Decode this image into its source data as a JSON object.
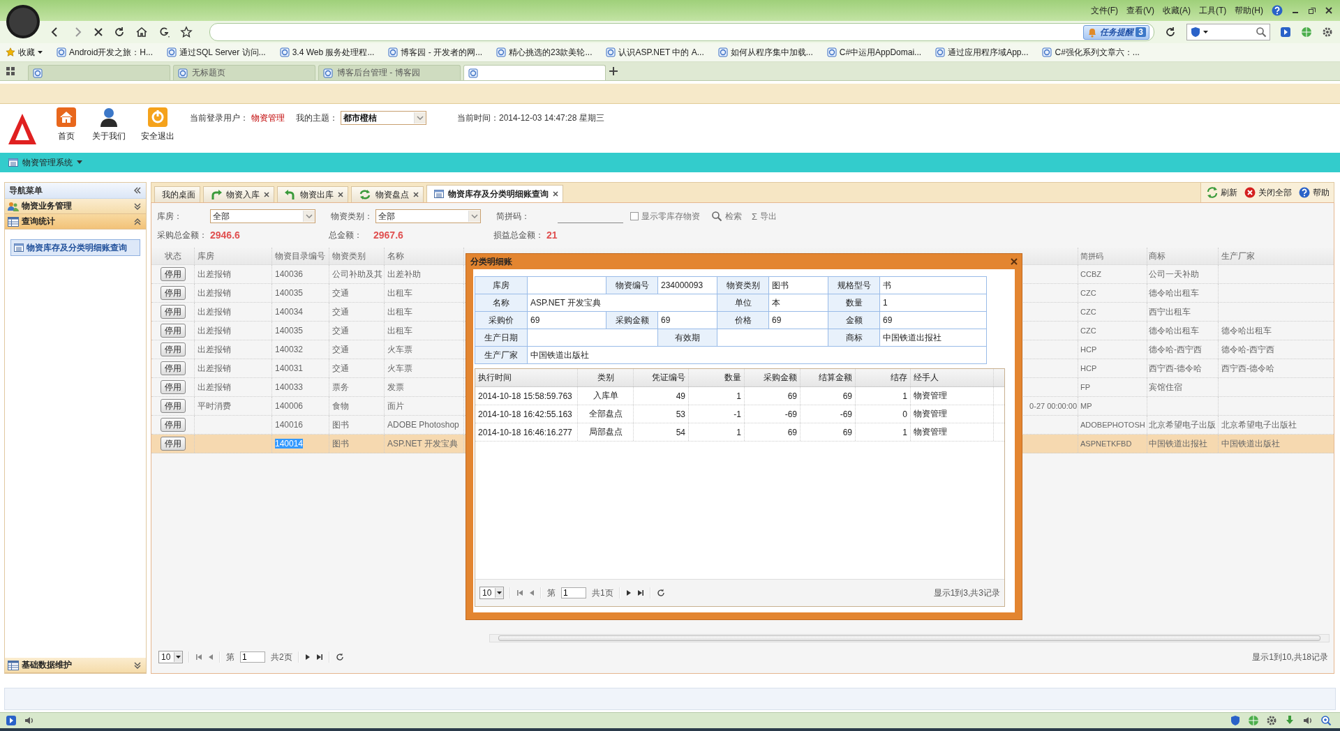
{
  "browser": {
    "menu": [
      "文件(F)",
      "查看(V)",
      "收藏(A)",
      "工具(T)",
      "帮助(H)"
    ],
    "notice": {
      "label": "任务提醒",
      "count": "3"
    },
    "favorites_label": "收藏",
    "favorites": [
      "Android开发之旅：H...",
      "通过SQL Server 访问...",
      "3.4 Web 服务处理程...",
      "博客园 - 开发者的网...",
      "精心挑选的23款美轮...",
      "认识ASP.NET 中的 A...",
      "如何从程序集中加载...",
      "C#中运用AppDomai...",
      "通过应用程序域App...",
      "C#强化系列文章六：..."
    ],
    "tabs": [
      {
        "selected": false
      },
      {
        "label": "无标题页",
        "selected": false
      },
      {
        "label": "博客后台管理 - 博客园",
        "selected": false
      },
      {
        "selected": true
      }
    ]
  },
  "app": {
    "nav": [
      {
        "kind": "home",
        "label": "首页"
      },
      {
        "kind": "about",
        "label": "关于我们"
      },
      {
        "kind": "logout",
        "label": "安全退出"
      }
    ],
    "user_label": "当前登录用户：",
    "user": "物资管理",
    "theme_label": "我的主题：",
    "theme": "都市橙桔",
    "time": "当前时间：2014-12-03 14:47:28 星期三",
    "system_menu": "物资管理系统"
  },
  "sidebar": {
    "title": "导航菜单",
    "groups": [
      {
        "label": "物资业务管理",
        "kind": "users",
        "expanded": false
      },
      {
        "label": "查询统计",
        "kind": "table",
        "expanded": true,
        "items": [
          {
            "label": "物资库存及分类明细账查询",
            "selected": true
          }
        ]
      },
      {
        "label": "基础数据维护",
        "kind": "table",
        "expanded": false
      }
    ]
  },
  "tabs": [
    {
      "kind": "desktop",
      "label": "我的桌面",
      "closable": false,
      "selected": false
    },
    {
      "kind": "inbound",
      "label": "物资入库",
      "closable": true,
      "selected": false
    },
    {
      "kind": "outbound",
      "label": "物资出库",
      "closable": true,
      "selected": false
    },
    {
      "kind": "stocktake",
      "label": "物资盘点",
      "closable": true,
      "selected": false
    },
    {
      "kind": "query",
      "label": "物资库存及分类明细账查询",
      "closable": true,
      "selected": true
    }
  ],
  "tab_tools": [
    {
      "kind": "refresh",
      "label": "刷新"
    },
    {
      "kind": "close-all",
      "label": "关闭全部"
    },
    {
      "kind": "help",
      "label": "帮助"
    }
  ],
  "filters": {
    "warehouse_label": "库房：",
    "warehouse": "全部",
    "category_label": "物资类别：",
    "category": "全部",
    "pinyin_label": "简拼码：",
    "zero_stock": {
      "label": "显示零库存物资",
      "checked": false
    },
    "search": "检索",
    "export_glyph": "Σ",
    "export": "导出"
  },
  "totals": [
    {
      "label": "采购总金额：",
      "value": "2946.6"
    },
    {
      "label": "总金额：",
      "value": "2967.6"
    },
    {
      "label": "损益总金额：",
      "value": "21"
    }
  ],
  "grid": {
    "columns": [
      "状态",
      "库房",
      "物资目录编号",
      "物资类别",
      "名称",
      "简拼码",
      "商标",
      "生产厂家"
    ],
    "rows": [
      {
        "status_button": "停用",
        "warehouse": "出差报销",
        "code": "140036",
        "category": "公司补助及其",
        "name": "出差补助",
        "jianpin": "CCBZ",
        "brand": "公司一天补助",
        "selected": false,
        "code_highlighted": false
      },
      {
        "status_button": "停用",
        "warehouse": "出差报销",
        "code": "140035",
        "category": "交通",
        "name": "出租车",
        "jianpin": "CZC",
        "brand": "德令哈出租车",
        "selected": false,
        "code_highlighted": false
      },
      {
        "status_button": "停用",
        "warehouse": "出差报销",
        "code": "140034",
        "category": "交通",
        "name": "出租车",
        "jianpin": "CZC",
        "brand": "西宁出租车",
        "selected": false,
        "code_highlighted": false
      },
      {
        "status_button": "停用",
        "warehouse": "出差报销",
        "code": "140035",
        "category": "交通",
        "name": "出租车",
        "jianpin": "CZC",
        "brand": "德令哈出租车",
        "maker": "德令哈出租车",
        "selected": false,
        "code_highlighted": false
      },
      {
        "status_button": "停用",
        "warehouse": "出差报销",
        "code": "140032",
        "category": "交通",
        "name": "火车票",
        "jianpin": "HCP",
        "brand": "德令哈-西宁西",
        "maker": "德令哈-西宁西",
        "selected": false,
        "code_highlighted": false
      },
      {
        "status_button": "停用",
        "warehouse": "出差报销",
        "code": "140031",
        "category": "交通",
        "name": "火车票",
        "jianpin": "HCP",
        "brand": "西宁西-德令哈",
        "maker": "西宁西-德令哈",
        "selected": false,
        "code_highlighted": false
      },
      {
        "status_button": "停用",
        "warehouse": "出差报销",
        "code": "140033",
        "category": "票务",
        "name": "发票",
        "jianpin": "FP",
        "brand": "宾馆住宿",
        "selected": false,
        "code_highlighted": false
      },
      {
        "status_button": "停用",
        "warehouse": "平时消费",
        "code": "140006",
        "category": "食物",
        "name": "面片",
        "column_6": "0-27 00:00:00",
        "jianpin": "MP",
        "selected": false,
        "code_highlighted": false
      },
      {
        "status_button": "停用",
        "code": "140016",
        "category": "图书",
        "name": "ADOBE Photoshop",
        "jianpin": "ADOBEPHOTOSH",
        "brand": "北京希望电子出版",
        "maker": "北京希望电子出版社",
        "selected": false,
        "code_highlighted": false
      },
      {
        "status_button": "停用",
        "code": "140014",
        "category": "图书",
        "name": "ASP.NET 开发宝典",
        "jianpin": "ASPNETKFBD",
        "brand": "中国铁道出报社",
        "maker": "中国铁道出版社",
        "selected": true,
        "code_highlighted": true
      }
    ],
    "pager": {
      "page_size": "10",
      "page_label": "第",
      "page": "1",
      "total_pages": "共2页",
      "summary": "显示1到10,共18记录"
    }
  },
  "dialog": {
    "title": "分类明细账",
    "info_rows": [
      [
        {
          "kind": "label",
          "text": "库房"
        },
        {
          "kind": "value"
        },
        {
          "kind": "label",
          "text": "物资编号"
        },
        {
          "kind": "value",
          "text": "234000093"
        },
        {
          "kind": "label",
          "text": "物资类别"
        },
        {
          "kind": "value",
          "text": "图书"
        },
        {
          "kind": "label",
          "text": "规格型号"
        },
        {
          "kind": "value",
          "text": "书"
        }
      ],
      [
        {
          "kind": "label",
          "text": "名称"
        },
        {
          "kind": "value",
          "text": "ASP.NET 开发宝典"
        },
        {
          "kind": "label",
          "text": "单位"
        },
        {
          "kind": "value",
          "text": "本"
        },
        {
          "kind": "label",
          "text": "数量"
        },
        {
          "kind": "value",
          "text": "1"
        }
      ],
      [
        {
          "kind": "label",
          "text": "采购价"
        },
        {
          "kind": "value",
          "text": "69"
        },
        {
          "kind": "label",
          "text": "采购金额"
        },
        {
          "kind": "value",
          "text": "69"
        },
        {
          "kind": "label",
          "text": "价格"
        },
        {
          "kind": "value",
          "text": "69"
        },
        {
          "kind": "label",
          "text": "金额"
        },
        {
          "kind": "value",
          "text": "69"
        }
      ],
      [
        {
          "kind": "label",
          "text": "生产日期"
        },
        {
          "kind": "value"
        },
        {
          "kind": "label",
          "text": "有效期"
        },
        {
          "kind": "value"
        },
        {
          "kind": "label",
          "text": "商标"
        },
        {
          "kind": "value",
          "text": "中国铁道出报社"
        }
      ],
      [
        {
          "kind": "label",
          "text": "生产厂家"
        },
        {
          "kind": "value",
          "text": "中国铁道出版社"
        }
      ]
    ],
    "detail": {
      "columns": [
        "执行时间",
        "类别",
        "凭证编号",
        "数量",
        "采购金额",
        "结算金额",
        "结存",
        "经手人"
      ],
      "rows": [
        [
          "2014-10-18 15:58:59.763",
          "入库单",
          "49",
          "1",
          "69",
          "69",
          "1",
          "物资管理"
        ],
        [
          "2014-10-18 16:42:55.163",
          "全部盘点",
          "53",
          "-1",
          "-69",
          "-69",
          "0",
          "物资管理"
        ],
        [
          "2014-10-18 16:46:16.277",
          "局部盘点",
          "54",
          "1",
          "69",
          "69",
          "1",
          "物资管理"
        ]
      ],
      "pager": {
        "page_size": "10",
        "page_label": "第",
        "page": "1",
        "total_pages": "共1页",
        "summary": "显示1到3,共3记录"
      }
    }
  }
}
